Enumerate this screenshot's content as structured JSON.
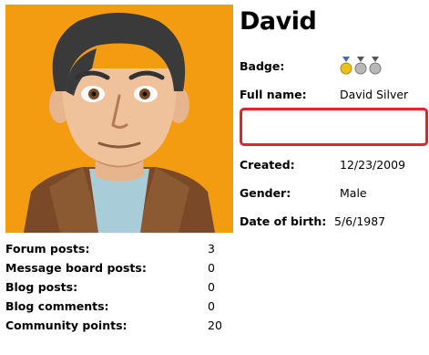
{
  "profile": {
    "name": "David",
    "avatar_icon": "cartoon-avatar-man",
    "highlight_color": "#e8202a",
    "badge": {
      "label": "Badge:",
      "medals": [
        "gold",
        "silver",
        "silver"
      ]
    },
    "full_name": {
      "label": "Full name:",
      "value": "David Silver"
    },
    "created": {
      "label": "Created:",
      "value": "12/23/2009"
    },
    "gender": {
      "label": "Gender:",
      "value": "Male"
    },
    "dob": {
      "label": "Date of birth:",
      "value": "5/6/1987"
    }
  },
  "stats": [
    {
      "label": "Forum posts:",
      "value": "3"
    },
    {
      "label": "Message board posts:",
      "value": "0"
    },
    {
      "label": "Blog posts:",
      "value": "0"
    },
    {
      "label": "Blog comments:",
      "value": "0"
    },
    {
      "label": "Community points:",
      "value": "20"
    }
  ]
}
